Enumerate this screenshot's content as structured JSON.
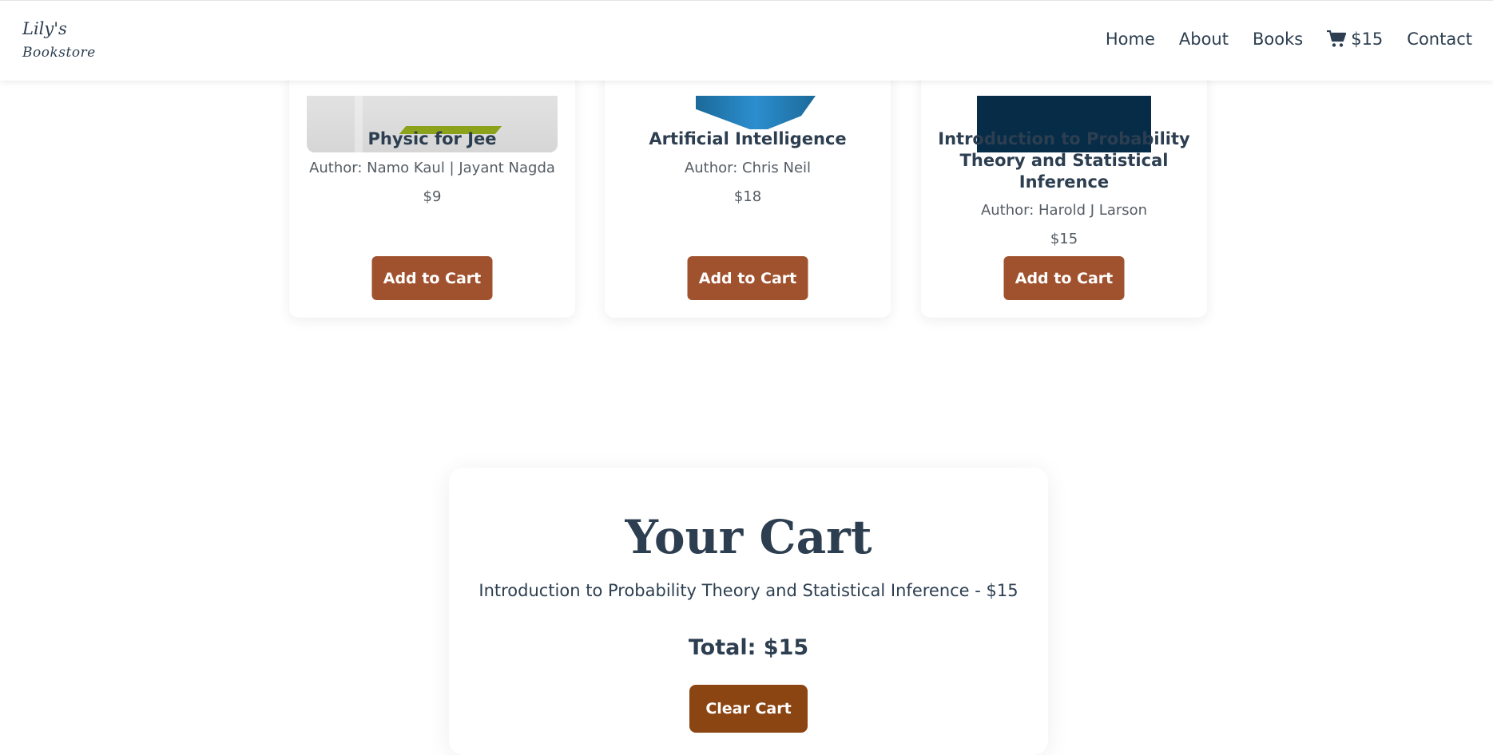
{
  "header": {
    "logo_line1": "Lily's",
    "logo_line2": "Bookstore",
    "nav": {
      "home": "Home",
      "about": "About",
      "books": "Books",
      "cart_total": "$15",
      "contact": "Contact"
    },
    "cart_icon": "shopping-cart-icon"
  },
  "books": [
    {
      "title": "Physic for Jee",
      "author": "Author: Namo Kaul | Jayant Nagda",
      "price": "$9",
      "button": "Add to Cart"
    },
    {
      "title": "Artificial Intelligence",
      "author": "Author: Chris Neil",
      "price": "$18",
      "button": "Add to Cart"
    },
    {
      "title": "Introduction to Probability Theory and Statistical Inference",
      "author": "Author: Harold J Larson",
      "price": "$15",
      "button": "Add to Cart"
    }
  ],
  "cart": {
    "title": "Your Cart",
    "items": [
      "Introduction to Probability Theory and Statistical Inference - $15"
    ],
    "total": "Total: $15",
    "clear_button": "Clear Cart"
  },
  "colors": {
    "text": "#2c3e50",
    "add_button": "#a0512d",
    "clear_button": "#8b4513",
    "cover_dark": "#062c47"
  }
}
